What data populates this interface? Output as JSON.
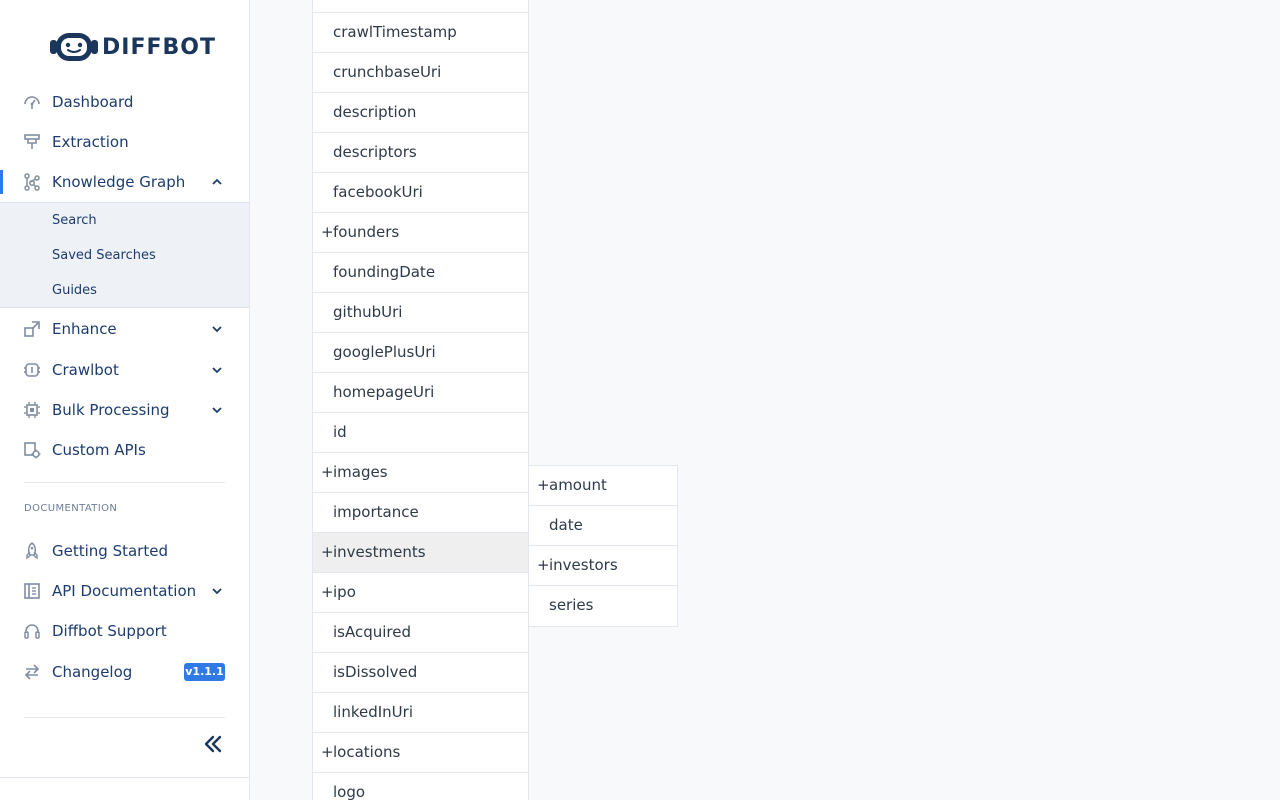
{
  "brand": {
    "name": "DIFFBOT"
  },
  "sidebar": {
    "items": [
      {
        "label": "Dashboard",
        "icon": "dashboard-icon"
      },
      {
        "label": "Extraction",
        "icon": "extraction-icon"
      },
      {
        "label": "Knowledge Graph",
        "icon": "knowledge-graph-icon",
        "expanded": true
      },
      {
        "label": "Enhance",
        "icon": "enhance-icon"
      },
      {
        "label": "Crawlbot",
        "icon": "crawlbot-icon"
      },
      {
        "label": "Bulk Processing",
        "icon": "bulk-processing-icon"
      },
      {
        "label": "Custom APIs",
        "icon": "custom-apis-icon"
      }
    ],
    "kg_sub_items": [
      "Search",
      "Saved Searches",
      "Guides"
    ],
    "doc_section_label": "DOCUMENTATION",
    "doc_items": [
      {
        "label": "Getting Started",
        "icon": "rocket-icon"
      },
      {
        "label": "API Documentation",
        "icon": "book-icon"
      },
      {
        "label": "Diffbot Support",
        "icon": "headset-icon"
      },
      {
        "label": "Changelog",
        "icon": "swap-icon",
        "badge": "v1.1.1"
      }
    ],
    "accent_color": "#2f7ae5"
  },
  "fields": [
    {
      "name": "crawlTimestamp",
      "expandable": false
    },
    {
      "name": "crunchbaseUri",
      "expandable": false
    },
    {
      "name": "description",
      "expandable": false
    },
    {
      "name": "descriptors",
      "expandable": false
    },
    {
      "name": "facebookUri",
      "expandable": false
    },
    {
      "name": "founders",
      "expandable": true
    },
    {
      "name": "foundingDate",
      "expandable": false
    },
    {
      "name": "githubUri",
      "expandable": false
    },
    {
      "name": "googlePlusUri",
      "expandable": false
    },
    {
      "name": "homepageUri",
      "expandable": false
    },
    {
      "name": "id",
      "expandable": false
    },
    {
      "name": "images",
      "expandable": true
    },
    {
      "name": "importance",
      "expandable": false
    },
    {
      "name": "investments",
      "expandable": true,
      "selected": true
    },
    {
      "name": "ipo",
      "expandable": true
    },
    {
      "name": "isAcquired",
      "expandable": false
    },
    {
      "name": "isDissolved",
      "expandable": false
    },
    {
      "name": "linkedInUri",
      "expandable": false
    },
    {
      "name": "locations",
      "expandable": true
    },
    {
      "name": "logo",
      "expandable": false
    }
  ],
  "investment_fields": [
    {
      "name": "amount",
      "expandable": true
    },
    {
      "name": "date",
      "expandable": false
    },
    {
      "name": "investors",
      "expandable": true
    },
    {
      "name": "series",
      "expandable": false
    }
  ]
}
